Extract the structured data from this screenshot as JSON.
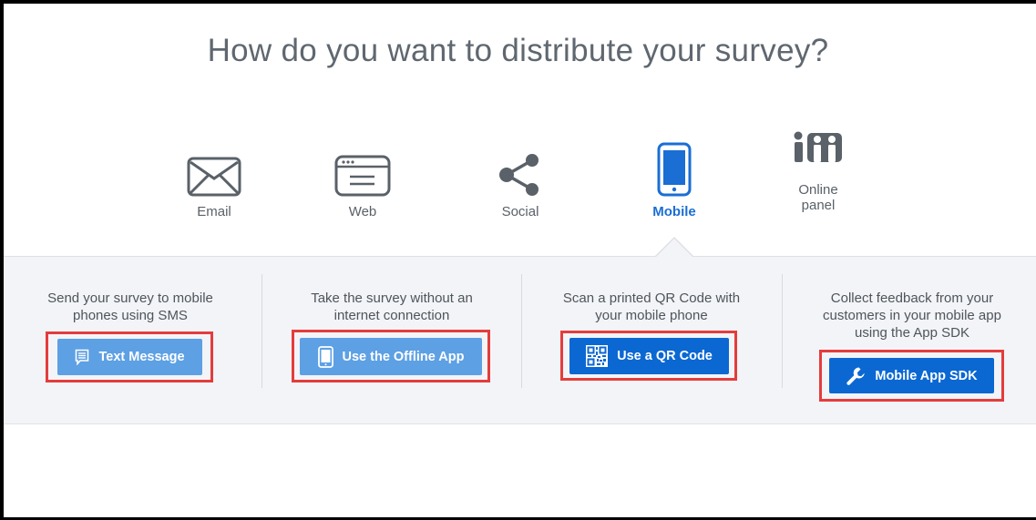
{
  "title": "How do you want to distribute your survey?",
  "channels": [
    {
      "label": "Email",
      "icon": "envelope-icon",
      "active": false
    },
    {
      "label": "Web",
      "icon": "browser-window-icon",
      "active": false
    },
    {
      "label": "Social",
      "icon": "share-icon",
      "active": false
    },
    {
      "label": "Mobile",
      "icon": "mobile-phone-icon",
      "active": true
    },
    {
      "label_line1": "Online",
      "label_line2": "panel",
      "icon": "people-panel-icon",
      "active": false
    }
  ],
  "mobile_options": [
    {
      "description_line1": "Send your survey to mobile",
      "description_line2": "phones using SMS",
      "button_label": "Text Message",
      "button_icon": "message-icon"
    },
    {
      "description_line1": "Take the survey without an",
      "description_line2": "internet connection",
      "button_label": "Use the Offline App",
      "button_icon": "tablet-icon"
    },
    {
      "description_line1": "Scan a printed QR Code with",
      "description_line2": "your mobile phone",
      "button_label": "Use a QR Code",
      "button_icon": "qr-code-icon"
    },
    {
      "description_line1": "Collect feedback from your",
      "description_line2": "customers in your mobile app",
      "description_line3": "using the App SDK",
      "button_label": "Mobile App SDK",
      "button_icon": "wrench-icon"
    }
  ],
  "colors": {
    "accent": "#1a6ed4",
    "button_light": "#5da0e4",
    "button_dark": "#0b68d2",
    "highlight": "#e43c3c",
    "panel_bg": "#f3f4f7"
  }
}
